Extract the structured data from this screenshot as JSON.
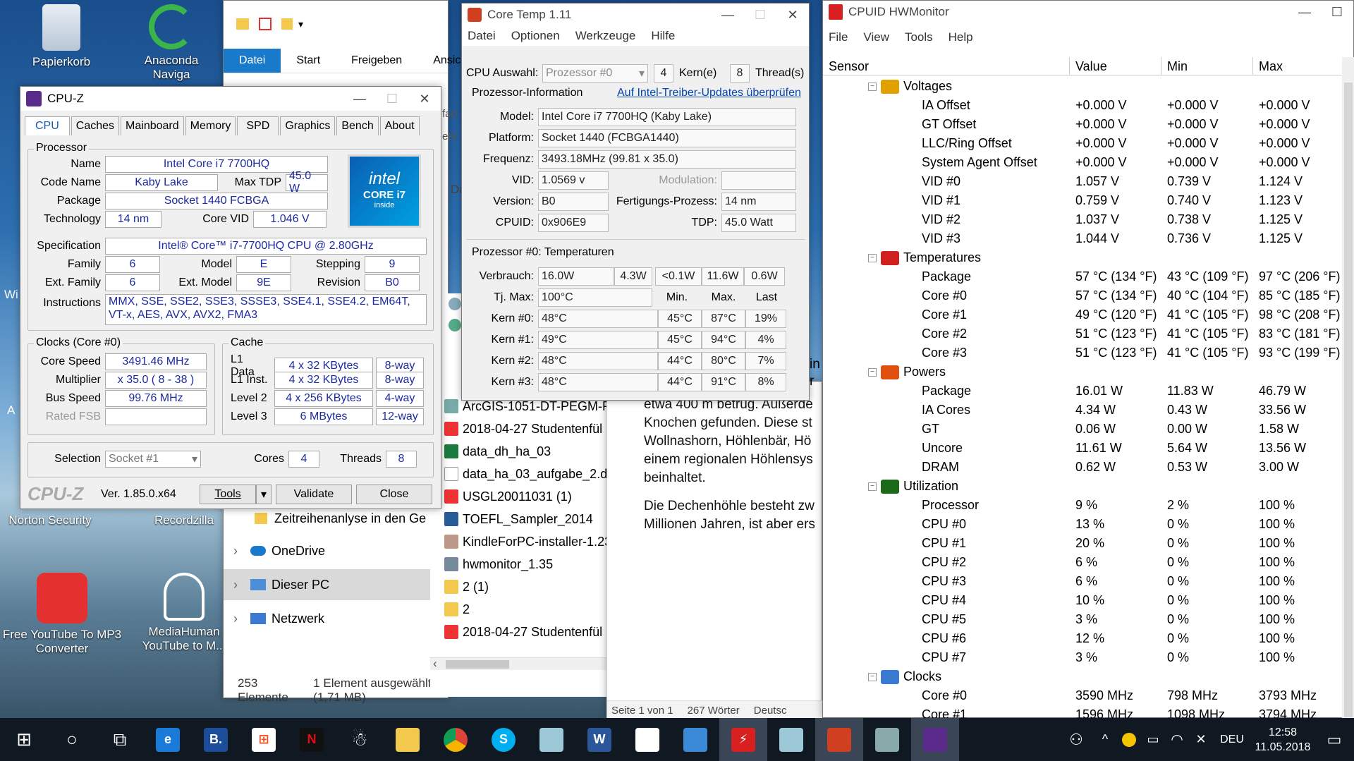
{
  "desktop": {
    "icons": [
      {
        "label": "Papierkorb"
      },
      {
        "label": "Anaconda Naviga"
      },
      {
        "label": "Norton Security"
      },
      {
        "label": "Recordzilla"
      },
      {
        "label": "Free YouTube To MP3 Converter"
      },
      {
        "label": "MediaHuman YouTube to M..."
      }
    ],
    "edge_labels": [
      "Wi",
      "A"
    ]
  },
  "explorer": {
    "tabs": [
      "Datei",
      "Start",
      "Freigeben",
      "Ansicht"
    ],
    "nav": [
      {
        "label": "Zeitreihenanlyse in den Ge"
      },
      {
        "label": "OneDrive"
      },
      {
        "label": "Dieser PC"
      },
      {
        "label": "Netzwerk"
      }
    ],
    "files": [
      "ArcGIS-1051-DT-PEGM-P",
      "2018-04-27 Studentenfül",
      "data_dh_ha_03",
      "data_ha_03_aufgabe_2.da",
      "USGL20011031 (1)",
      "TOEFL_Sampler_2014",
      "KindleForPC-installer-1.23",
      "hwmonitor_1.35",
      "2 (1)",
      "2",
      "2018-04-27 Studentenfül"
    ],
    "status": {
      "count": "253 Elemente",
      "selected": "1 Element ausgewählt (1,71 MB)"
    },
    "side_letters": [
      "fad",
      "erk",
      "Da"
    ]
  },
  "cpuz": {
    "title": "CPU-Z",
    "tabs": [
      "CPU",
      "Caches",
      "Mainboard",
      "Memory",
      "SPD",
      "Graphics",
      "Bench",
      "About"
    ],
    "processor": {
      "legend": "Processor",
      "name_label": "Name",
      "name": "Intel Core i7 7700HQ",
      "codename_label": "Code Name",
      "codename": "Kaby Lake",
      "maxtdp_label": "Max TDP",
      "maxtdp": "45.0 W",
      "package_label": "Package",
      "package": "Socket 1440 FCBGA",
      "tech_label": "Technology",
      "tech": "14 nm",
      "corevid_label": "Core VID",
      "corevid": "1.046 V",
      "spec_label": "Specification",
      "spec": "Intel® Core™ i7-7700HQ CPU @ 2.80GHz",
      "family_label": "Family",
      "family": "6",
      "model_label": "Model",
      "model": "E",
      "stepping_label": "Stepping",
      "stepping": "9",
      "extfamily_label": "Ext. Family",
      "extfamily": "6",
      "extmodel_label": "Ext. Model",
      "extmodel": "9E",
      "revision_label": "Revision",
      "revision": "B0",
      "instr_label": "Instructions",
      "instr": "MMX, SSE, SSE2, SSE3, SSSE3, SSE4.1, SSE4.2, EM64T, VT-x, AES, AVX, AVX2, FMA3"
    },
    "logo": {
      "brand": "intel",
      "line1": "CORE i7",
      "line2": "inside"
    },
    "clocks": {
      "legend": "Clocks (Core #0)",
      "corespeed_label": "Core Speed",
      "corespeed": "3491.46 MHz",
      "multiplier_label": "Multiplier",
      "multiplier": "x 35.0 ( 8 - 38 )",
      "busspeed_label": "Bus Speed",
      "busspeed": "99.76 MHz",
      "ratedfsb_label": "Rated FSB"
    },
    "cache": {
      "legend": "Cache",
      "rows": [
        {
          "label": "L1 Data",
          "size": "4 x 32 KBytes",
          "way": "8-way"
        },
        {
          "label": "L1 Inst.",
          "size": "4 x 32 KBytes",
          "way": "8-way"
        },
        {
          "label": "Level 2",
          "size": "4 x 256 KBytes",
          "way": "4-way"
        },
        {
          "label": "Level 3",
          "size": "6 MBytes",
          "way": "12-way"
        }
      ]
    },
    "selection_label": "Selection",
    "selection": "Socket #1",
    "cores_label": "Cores",
    "cores": "4",
    "threads_label": "Threads",
    "threads": "8",
    "footer": {
      "brand": "CPU-Z",
      "version": "Ver. 1.85.0.x64",
      "tools": "Tools",
      "validate": "Validate",
      "close": "Close"
    }
  },
  "coretemp": {
    "title": "Core Temp 1.11",
    "menu": [
      "Datei",
      "Optionen",
      "Werkzeuge",
      "Hilfe"
    ],
    "cpu_select_label": "CPU Auswahl:",
    "cpu_select": "Prozessor #0",
    "cores_count": "4",
    "cores_label": "Kern(e)",
    "threads_count": "8",
    "threads_label": "Thread(s)",
    "info_label": "Prozessor-Information",
    "update_link": "Auf Intel-Treiber-Updates überprüfen",
    "model_label": "Model:",
    "model": "Intel Core i7 7700HQ (Kaby Lake)",
    "platform_label": "Platform:",
    "platform": "Socket 1440 (FCBGA1440)",
    "freq_label": "Frequenz:",
    "freq": "3493.18MHz (99.81 x 35.0)",
    "vid_label": "VID:",
    "vid": "1.0569 v",
    "modulation_label": "Modulation:",
    "version_label": "Version:",
    "version": "B0",
    "process_label": "Fertigungs-Prozess:",
    "process": "14 nm",
    "cpuid_label": "CPUID:",
    "cpuid": "0x906E9",
    "tdp_label": "TDP:",
    "tdp": "45.0 Watt",
    "temps_label": "Prozessor #0: Temperaturen",
    "power_label": "Verbrauch:",
    "power": [
      "16.0W",
      "4.3W",
      "<0.1W",
      "11.6W",
      "0.6W"
    ],
    "tjmax_label": "Tj. Max:",
    "tjmax": "100°C",
    "col_min": "Min.",
    "col_max": "Max.",
    "col_last": "Last",
    "cores": [
      {
        "label": "Kern #0:",
        "temp": "48°C",
        "min": "45°C",
        "max": "87°C",
        "load": "19%"
      },
      {
        "label": "Kern #1:",
        "temp": "49°C",
        "min": "45°C",
        "max": "94°C",
        "load": "4%"
      },
      {
        "label": "Kern #2:",
        "temp": "48°C",
        "min": "44°C",
        "max": "80°C",
        "load": "7%"
      },
      {
        "label": "Kern #3:",
        "temp": "48°C",
        "min": "44°C",
        "max": "91°C",
        "load": "8%"
      }
    ]
  },
  "word": {
    "lines": [
      "etwa 400 m betrug. Außerde",
      "Knochen gefunden. Diese st",
      "Wollnashorn, Höhlenbär, Hö",
      "einem regionalen Höhlensys",
      "beinhaltet.",
      "",
      "Die Dechenhöhle besteht zw",
      "Millionen Jahren, ist aber ers"
    ],
    "status": {
      "page": "Seite 1 von 1",
      "words": "267 Wörter",
      "lang": "Deutsc"
    },
    "side_letters": [
      "in",
      "r"
    ]
  },
  "hwmonitor": {
    "title": "CPUID HWMonitor",
    "menu": [
      "File",
      "View",
      "Tools",
      "Help"
    ],
    "columns": [
      "Sensor",
      "Value",
      "Min",
      "Max"
    ],
    "rows": [
      {
        "kind": "cat",
        "name": "Voltages",
        "color": "#e0a000"
      },
      {
        "name": "IA Offset",
        "value": "+0.000 V",
        "min": "+0.000 V",
        "max": "+0.000 V"
      },
      {
        "name": "GT Offset",
        "value": "+0.000 V",
        "min": "+0.000 V",
        "max": "+0.000 V"
      },
      {
        "name": "LLC/Ring Offset",
        "value": "+0.000 V",
        "min": "+0.000 V",
        "max": "+0.000 V"
      },
      {
        "name": "System Agent Offset",
        "value": "+0.000 V",
        "min": "+0.000 V",
        "max": "+0.000 V"
      },
      {
        "name": "VID #0",
        "value": "1.057 V",
        "min": "0.739 V",
        "max": "1.124 V"
      },
      {
        "name": "VID #1",
        "value": "0.759 V",
        "min": "0.740 V",
        "max": "1.123 V"
      },
      {
        "name": "VID #2",
        "value": "1.037 V",
        "min": "0.738 V",
        "max": "1.125 V"
      },
      {
        "name": "VID #3",
        "value": "1.044 V",
        "min": "0.736 V",
        "max": "1.125 V"
      },
      {
        "kind": "cat",
        "name": "Temperatures",
        "color": "#d02020"
      },
      {
        "name": "Package",
        "value": "57 °C  (134 °F)",
        "min": "43 °C  (109 °F)",
        "max": "97 °C  (206 °F)"
      },
      {
        "name": "Core #0",
        "value": "57 °C  (134 °F)",
        "min": "40 °C  (104 °F)",
        "max": "85 °C  (185 °F)"
      },
      {
        "name": "Core #1",
        "value": "49 °C  (120 °F)",
        "min": "41 °C  (105 °F)",
        "max": "98 °C  (208 °F)"
      },
      {
        "name": "Core #2",
        "value": "51 °C  (123 °F)",
        "min": "41 °C  (105 °F)",
        "max": "83 °C  (181 °F)"
      },
      {
        "name": "Core #3",
        "value": "51 °C  (123 °F)",
        "min": "41 °C  (105 °F)",
        "max": "93 °C  (199 °F)"
      },
      {
        "kind": "cat",
        "name": "Powers",
        "color": "#e05010"
      },
      {
        "name": "Package",
        "value": "16.01 W",
        "min": "11.83 W",
        "max": "46.79 W"
      },
      {
        "name": "IA Cores",
        "value": "4.34 W",
        "min": "0.43 W",
        "max": "33.56 W"
      },
      {
        "name": "GT",
        "value": "0.06 W",
        "min": "0.00 W",
        "max": "1.58 W"
      },
      {
        "name": "Uncore",
        "value": "11.61 W",
        "min": "5.64 W",
        "max": "13.56 W"
      },
      {
        "name": "DRAM",
        "value": "0.62 W",
        "min": "0.53 W",
        "max": "3.00 W"
      },
      {
        "kind": "cat",
        "name": "Utilization",
        "color": "#1a6a1a"
      },
      {
        "name": "Processor",
        "value": "9 %",
        "min": "2 %",
        "max": "100 %"
      },
      {
        "name": "CPU #0",
        "value": "13 %",
        "min": "0 %",
        "max": "100 %"
      },
      {
        "name": "CPU #1",
        "value": "20 %",
        "min": "0 %",
        "max": "100 %"
      },
      {
        "name": "CPU #2",
        "value": "6 %",
        "min": "0 %",
        "max": "100 %"
      },
      {
        "name": "CPU #3",
        "value": "6 %",
        "min": "0 %",
        "max": "100 %"
      },
      {
        "name": "CPU #4",
        "value": "10 %",
        "min": "0 %",
        "max": "100 %"
      },
      {
        "name": "CPU #5",
        "value": "3 %",
        "min": "0 %",
        "max": "100 %"
      },
      {
        "name": "CPU #6",
        "value": "12 %",
        "min": "0 %",
        "max": "100 %"
      },
      {
        "name": "CPU #7",
        "value": "3 %",
        "min": "0 %",
        "max": "100 %"
      },
      {
        "kind": "cat",
        "name": "Clocks",
        "color": "#3a7ad0"
      },
      {
        "name": "Core #0",
        "value": "3590 MHz",
        "min": "798 MHz",
        "max": "3793 MHz"
      },
      {
        "name": "Core #1",
        "value": "1596 MHz",
        "min": "1098 MHz",
        "max": "3794 MHz"
      }
    ]
  },
  "taskbar": {
    "apps": [
      "start-icon",
      "search-icon",
      "task-view-icon",
      "edge-icon",
      "b-app-icon",
      "store-icon",
      "netflix-icon",
      "mediahuman-icon",
      "explorer-icon",
      "chrome-icon",
      "skype-icon",
      "app-icon",
      "word-icon",
      "photos-icon",
      "image-icon",
      "hwmonitor-icon",
      "app-icon",
      "coretemp-icon",
      "app-icon",
      "cpuz-icon"
    ],
    "b_label": "B.",
    "lang": "DEU",
    "time": "12:58",
    "date": "11.05.2018"
  }
}
